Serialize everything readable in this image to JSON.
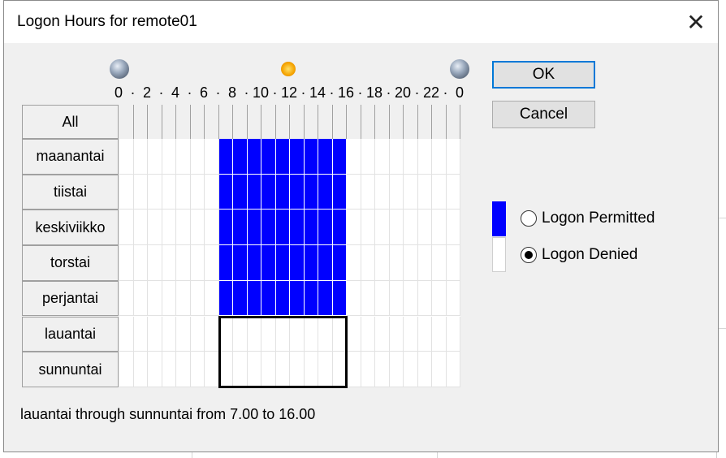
{
  "dialog": {
    "title": "Logon Hours for remote01",
    "close_icon": "close-icon"
  },
  "time_header": {
    "labels": [
      "0",
      "2",
      "4",
      "6",
      "8",
      "10",
      "12",
      "14",
      "16",
      "18",
      "20",
      "22",
      "0"
    ],
    "icons": [
      "moon-icon",
      "sun-icon",
      "moon-icon"
    ]
  },
  "grid": {
    "all_label": "All",
    "days": [
      "maanantai",
      "tiistai",
      "keskiviikko",
      "torstai",
      "perjantai",
      "lauantai",
      "sunnuntai"
    ],
    "hours_per_day": 24,
    "permitted": [
      {
        "days": [
          "maanantai",
          "tiistai",
          "keskiviikko",
          "torstai",
          "perjantai"
        ],
        "from_hour": 7,
        "to_hour": 16
      }
    ],
    "selection": {
      "from_day": "lauantai",
      "to_day": "sunnuntai",
      "from_hour": 7,
      "to_hour": 16
    }
  },
  "buttons": {
    "ok": "OK",
    "cancel": "Cancel"
  },
  "legend": {
    "permitted_label": "Logon Permitted",
    "denied_label": "Logon Denied",
    "permitted_color": "#0000ff",
    "denied_color": "#ffffff",
    "selected": "denied"
  },
  "status": {
    "text": "lauantai through sunnuntai from 7.00 to 16.00"
  }
}
